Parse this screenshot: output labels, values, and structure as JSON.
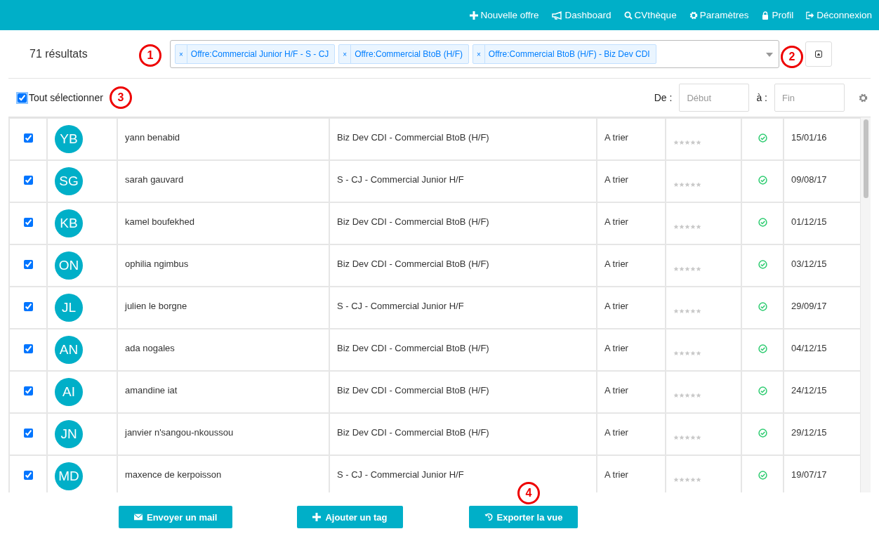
{
  "nav": [
    {
      "label": "Nouvelle offre"
    },
    {
      "label": "Dashboard"
    },
    {
      "label": "CVthèque"
    },
    {
      "label": "Paramètres"
    },
    {
      "label": "Profil"
    },
    {
      "label": "Déconnexion"
    }
  ],
  "results_count": "71 résultats",
  "filter_tags": [
    {
      "remove": "×",
      "label": "Offre:Commercial Junior H/F - S - CJ"
    },
    {
      "remove": "×",
      "label": "Offre:Commercial BtoB (H/F)"
    },
    {
      "remove": "×",
      "label": "Offre:Commercial BtoB (H/F) - Biz Dev CDI"
    }
  ],
  "select_all": {
    "label": "Tout sélectionner",
    "checked": true
  },
  "date_range": {
    "from_label": "De :",
    "from_placeholder": "Début",
    "to_label": "à :",
    "to_placeholder": "Fin"
  },
  "rows": [
    {
      "checked": true,
      "initials": "YB",
      "name": "yann benabid",
      "offer": "Biz Dev CDI - Commercial BtoB (H/F)",
      "status": "A trier",
      "stars": 0,
      "validated": true,
      "date": "15/01/16"
    },
    {
      "checked": true,
      "initials": "SG",
      "name": "sarah gauvard",
      "offer": "S - CJ - Commercial Junior H/F",
      "status": "A trier",
      "stars": 0,
      "validated": true,
      "date": "09/08/17"
    },
    {
      "checked": true,
      "initials": "KB",
      "name": "kamel boufekhed",
      "offer": "Biz Dev CDI - Commercial BtoB (H/F)",
      "status": "A trier",
      "stars": 0,
      "validated": true,
      "date": "01/12/15"
    },
    {
      "checked": true,
      "initials": "ON",
      "name": "ophilia ngimbus",
      "offer": "Biz Dev CDI - Commercial BtoB (H/F)",
      "status": "A trier",
      "stars": 0,
      "validated": true,
      "date": "03/12/15"
    },
    {
      "checked": true,
      "initials": "JL",
      "name": "julien le borgne",
      "offer": "S - CJ - Commercial Junior H/F",
      "status": "A trier",
      "stars": 0,
      "validated": true,
      "date": "29/09/17"
    },
    {
      "checked": true,
      "initials": "AN",
      "name": "ada nogales",
      "offer": "Biz Dev CDI - Commercial BtoB (H/F)",
      "status": "A trier",
      "stars": 0,
      "validated": true,
      "date": "04/12/15"
    },
    {
      "checked": true,
      "initials": "AI",
      "name": "amandine iat",
      "offer": "Biz Dev CDI - Commercial BtoB (H/F)",
      "status": "A trier",
      "stars": 0,
      "validated": true,
      "date": "24/12/15"
    },
    {
      "checked": true,
      "initials": "JN",
      "name": "janvier n'sangou-nkoussou",
      "offer": "Biz Dev CDI - Commercial BtoB (H/F)",
      "status": "A trier",
      "stars": 0,
      "validated": true,
      "date": "29/12/15"
    },
    {
      "checked": true,
      "initials": "MD",
      "name": "maxence de kerpoisson",
      "offer": "S - CJ - Commercial Junior H/F",
      "status": "A trier",
      "stars": 0,
      "validated": true,
      "date": "19/07/17"
    }
  ],
  "actions": [
    {
      "label": "Envoyer un mail"
    },
    {
      "label": "Ajouter un tag"
    },
    {
      "label": "Exporter la vue"
    }
  ],
  "annotations": [
    {
      "number": "1"
    },
    {
      "number": "2"
    },
    {
      "number": "3"
    },
    {
      "number": "4"
    }
  ]
}
